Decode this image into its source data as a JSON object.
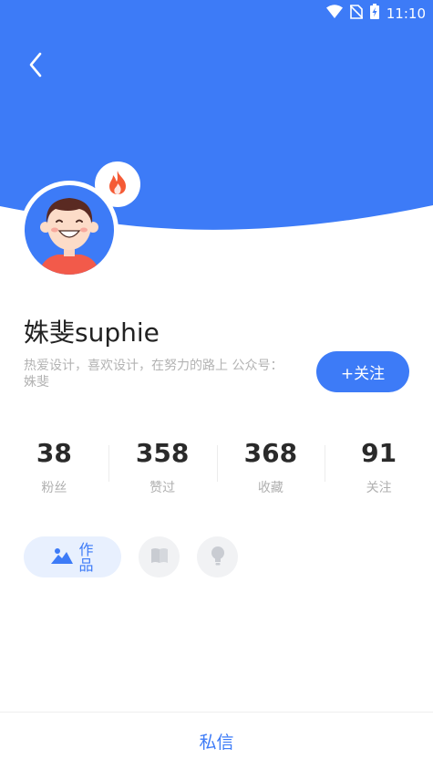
{
  "colors": {
    "accent": "#3d7bf7",
    "header": "#3d7bf7",
    "muted_text": "#b0b0b0",
    "tab_bg": "#e8f0fe",
    "fire": "#f55a35"
  },
  "status_bar": {
    "time": "11:10",
    "icons": [
      "wifi-icon",
      "no-sim-icon",
      "battery-charging-icon"
    ]
  },
  "header": {
    "back_icon": "chevron-left-icon"
  },
  "profile": {
    "name": "姝斐suphie",
    "bio": "热爱设计，喜欢设计，在努力的路上  公众号：姝斐",
    "badge_icon": "fire-icon",
    "follow_label": "+关注"
  },
  "stats": [
    {
      "value": "38",
      "label": "粉丝"
    },
    {
      "value": "358",
      "label": "赞过"
    },
    {
      "value": "368",
      "label": "收藏"
    },
    {
      "value": "91",
      "label": "关注"
    }
  ],
  "tabs": {
    "active_label": "作品",
    "active_icon": "mountain-image-icon",
    "others": [
      "book-icon",
      "lightbulb-icon"
    ]
  },
  "bottom": {
    "message_label": "私信"
  }
}
